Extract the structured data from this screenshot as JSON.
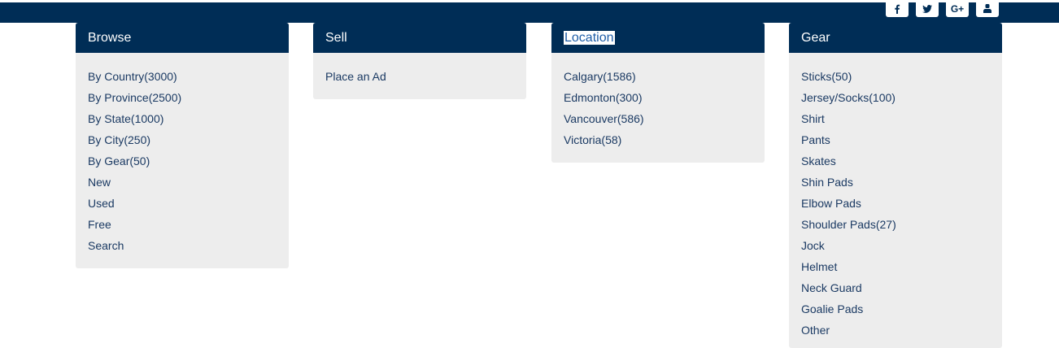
{
  "social": {
    "icons": [
      "facebook-icon",
      "twitter-icon",
      "google-plus-icon",
      "user-icon"
    ],
    "google_label": "G+"
  },
  "browse": {
    "title": "Browse",
    "items": [
      "By Country(3000)",
      "By Province(2500)",
      "By State(1000)",
      "By City(250)",
      "By Gear(50)",
      "New",
      "Used",
      "Free",
      "Search"
    ]
  },
  "sell": {
    "title": "Sell",
    "items": [
      "Place an Ad"
    ]
  },
  "location": {
    "title": "Location",
    "title_selected": true,
    "items": [
      "Calgary(1586)",
      "Edmonton(300)",
      "Vancouver(586)",
      "Victoria(58)"
    ]
  },
  "gear": {
    "title": "Gear",
    "items": [
      "Sticks(50)",
      "Jersey/Socks(100)",
      "Shirt",
      "Pants",
      "Skates",
      "Shin Pads",
      "Elbow Pads",
      "Shoulder Pads(27)",
      "Jock",
      "Helmet",
      "Neck Guard",
      "Goalie Pads",
      "Other"
    ]
  },
  "colors": {
    "header_bg": "#002d56",
    "panel_bg": "#ededed",
    "link": "#1b3a63",
    "selection_text": "#1f5ea8"
  }
}
